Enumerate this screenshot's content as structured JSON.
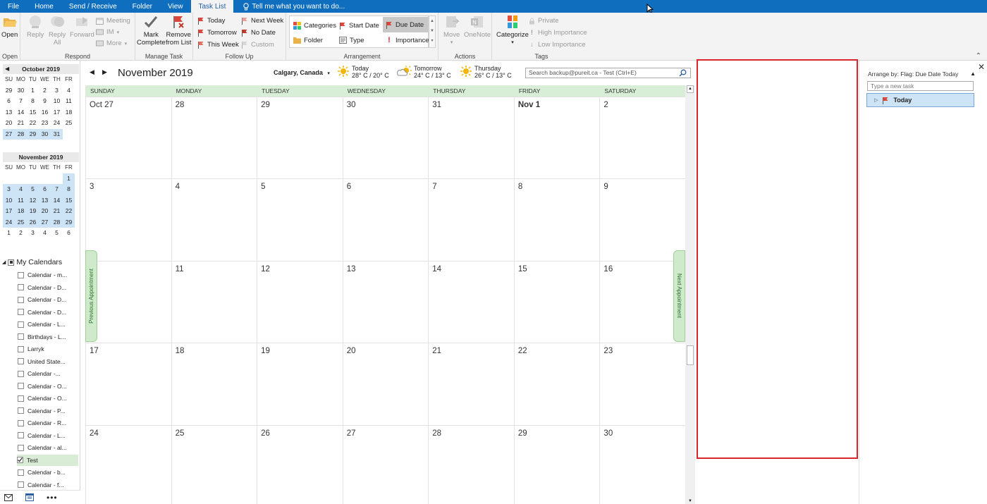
{
  "tabs": [
    "File",
    "Home",
    "Send / Receive",
    "Folder",
    "View",
    "Task List"
  ],
  "active_tab": "Task List",
  "tell_me": "Tell me what you want to do...",
  "ribbon": {
    "open": {
      "label": "Open",
      "group": "Open"
    },
    "respond": {
      "reply": "Reply",
      "reply_all_1": "Reply",
      "reply_all_2": "All",
      "forward": "Forward",
      "meeting": "Meeting",
      "im": "IM",
      "more": "More",
      "group": "Respond"
    },
    "manage": {
      "mark_1": "Mark",
      "mark_2": "Complete",
      "remove_1": "Remove",
      "remove_2": "from List",
      "group": "Manage Task"
    },
    "followup": {
      "today": "Today",
      "tomorrow": "Tomorrow",
      "this_week": "This Week",
      "next_week": "Next Week",
      "no_date": "No Date",
      "custom": "Custom",
      "group": "Follow Up"
    },
    "arrangement": {
      "categories": "Categories",
      "start_date": "Start Date",
      "due_date": "Due Date",
      "folder": "Folder",
      "type": "Type",
      "importance": "Importance",
      "group": "Arrangement"
    },
    "actions": {
      "move": "Move",
      "onenote": "OneNote",
      "group": "Actions"
    },
    "tags": {
      "categorize": "Categorize",
      "private": "Private",
      "high": "High Importance",
      "low": "Low Importance",
      "group": "Tags"
    }
  },
  "mini_cal_1": {
    "title": "October 2019",
    "headers": [
      "SU",
      "MO",
      "TU",
      "WE",
      "TH",
      "FR"
    ],
    "rows": [
      [
        "29",
        "30",
        "1",
        "2",
        "3",
        "4"
      ],
      [
        "6",
        "7",
        "8",
        "9",
        "10",
        "11"
      ],
      [
        "13",
        "14",
        "15",
        "16",
        "17",
        "18"
      ],
      [
        "20",
        "21",
        "22",
        "23",
        "24",
        "25"
      ],
      [
        "27",
        "28",
        "29",
        "30",
        "31",
        ""
      ]
    ]
  },
  "mini_cal_2": {
    "title": "November 2019",
    "headers": [
      "SU",
      "MO",
      "TU",
      "WE",
      "TH",
      "FR"
    ],
    "rows": [
      [
        "",
        "",
        "",
        "",
        "",
        "1"
      ],
      [
        "3",
        "4",
        "5",
        "6",
        "7",
        "8"
      ],
      [
        "10",
        "11",
        "12",
        "13",
        "14",
        "15"
      ],
      [
        "17",
        "18",
        "19",
        "20",
        "21",
        "22"
      ],
      [
        "24",
        "25",
        "26",
        "27",
        "28",
        "29"
      ],
      [
        "1",
        "2",
        "3",
        "4",
        "5",
        "6"
      ]
    ]
  },
  "my_calendars": {
    "title": "My Calendars",
    "items": [
      "Calendar - m...",
      "Calendar - D...",
      "Calendar - D...",
      "Calendar - D...",
      "Calendar - L...",
      "Birthdays - L...",
      "Larryk",
      "United State...",
      "Calendar -...",
      "Calendar - O...",
      "Calendar - O...",
      "Calendar - P...",
      "Calendar - R...",
      "Calendar - L...",
      "Calendar - al...",
      "Test",
      "Calendar - b...",
      "Calendar - f..."
    ],
    "checked": "Test"
  },
  "calendar": {
    "month_title": "November 2019",
    "location": "Calgary, Canada",
    "weather": [
      {
        "day": "Today",
        "temp": "28° C / 20° C"
      },
      {
        "day": "Tomorrow",
        "temp": "24° C / 13° C"
      },
      {
        "day": "Thursday",
        "temp": "26° C / 13° C"
      }
    ],
    "search_placeholder": "Search backup@pureit.ca - Test (Ctrl+E)",
    "day_headers": [
      "SUNDAY",
      "MONDAY",
      "TUESDAY",
      "WEDNESDAY",
      "THURSDAY",
      "FRIDAY",
      "SATURDAY"
    ],
    "weeks": [
      [
        "Oct 27",
        "28",
        "29",
        "30",
        "31",
        "Nov 1",
        "2"
      ],
      [
        "3",
        "4",
        "5",
        "6",
        "7",
        "8",
        "9"
      ],
      [
        "",
        "11",
        "12",
        "13",
        "14",
        "15",
        "16"
      ],
      [
        "17",
        "18",
        "19",
        "20",
        "21",
        "22",
        "23"
      ],
      [
        "24",
        "25",
        "26",
        "27",
        "28",
        "29",
        "30"
      ]
    ],
    "prev_appt": "Previous Appointment",
    "next_appt": "Next Appointment"
  },
  "tasks": {
    "arrange_by": "Arrange by: Flag: Due Date Today",
    "new_task_placeholder": "Type a new task",
    "group_today": "Today"
  }
}
